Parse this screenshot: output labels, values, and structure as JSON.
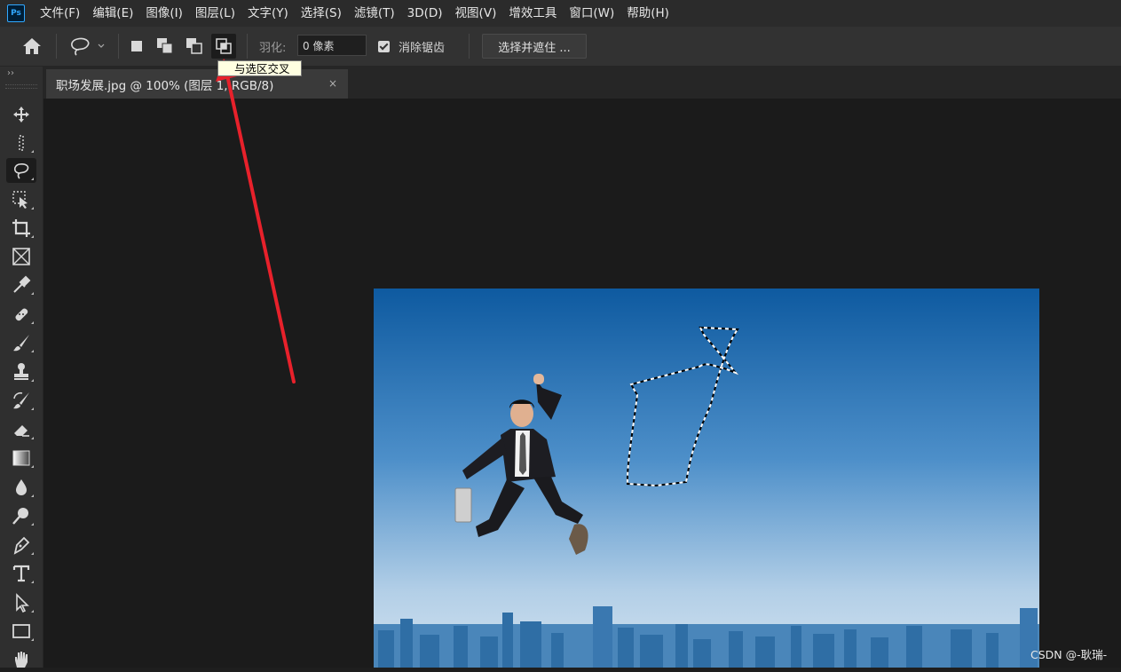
{
  "app": {
    "logo": "Ps"
  },
  "menu": [
    "文件(F)",
    "编辑(E)",
    "图像(I)",
    "图层(L)",
    "文字(Y)",
    "选择(S)",
    "滤镜(T)",
    "3D(D)",
    "视图(V)",
    "增效工具",
    "窗口(W)",
    "帮助(H)"
  ],
  "options": {
    "feather_label": "羽化:",
    "feather_value": "0 像素",
    "antialias_label": "消除锯齿",
    "select_mask_label": "选择并遮住 ...",
    "tooltip": "与选区交叉"
  },
  "document": {
    "tab_title": "职场发展.jpg @ 100% (图层 1, RGB/8)",
    "close_glyph": "×"
  },
  "watermark": "CSDN @-耿瑞-",
  "colors": {
    "accent_arrow": "#e8212b",
    "sky_top": "#0f5fa6",
    "sky_bottom": "#c9dcec"
  },
  "icons": {
    "toolbar": [
      "move-icon",
      "marquee-icon",
      "lasso-icon",
      "object-select-icon",
      "crop-icon",
      "frame-icon",
      "eyedropper-icon",
      "healing-icon",
      "brush-icon",
      "stamp-icon",
      "history-brush-icon",
      "eraser-icon",
      "gradient-icon",
      "blur-icon",
      "dodge-icon",
      "pen-icon",
      "type-icon",
      "path-select-icon",
      "rectangle-icon",
      "hand-icon"
    ]
  }
}
